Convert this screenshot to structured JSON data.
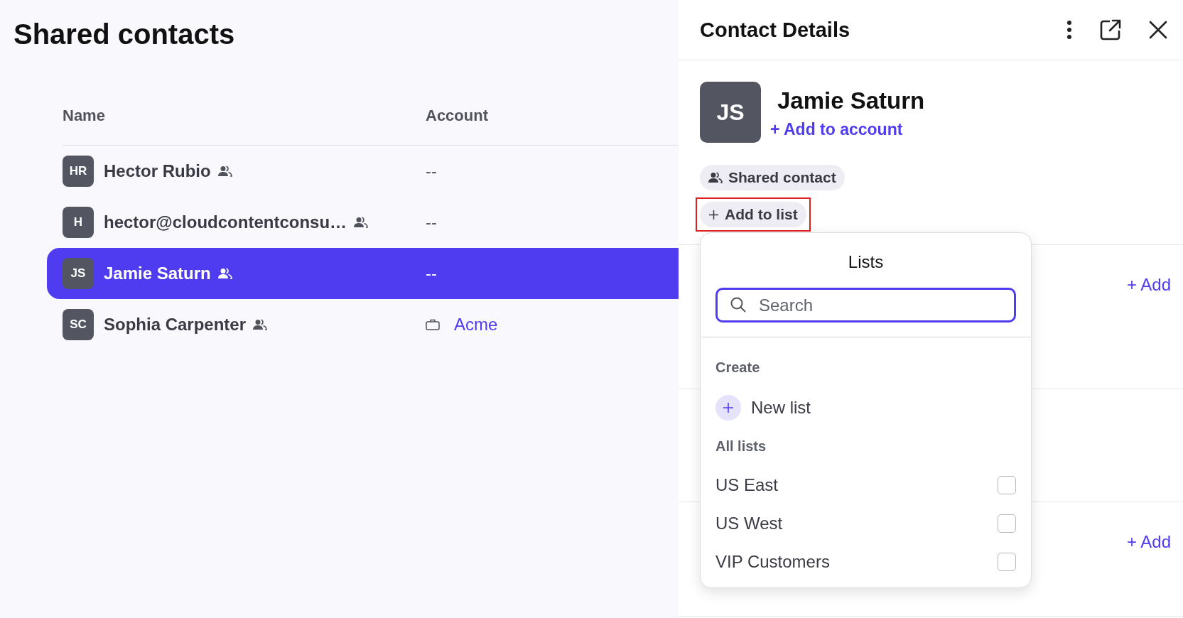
{
  "page": {
    "title": "Shared contacts"
  },
  "table": {
    "columns": [
      "Name",
      "Account"
    ],
    "rows": [
      {
        "initials": "HR",
        "name": "Hector Rubio",
        "shared": true,
        "account": "--",
        "kind": "none",
        "selected": false
      },
      {
        "initials": "H",
        "name": "hector@cloudcontentconsu…",
        "shared": true,
        "account": "--",
        "kind": "none",
        "selected": false
      },
      {
        "initials": "JS",
        "name": "Jamie Saturn",
        "shared": true,
        "account": "--",
        "kind": "none",
        "selected": true
      },
      {
        "initials": "SC",
        "name": "Sophia Carpenter",
        "shared": true,
        "account": "Acme",
        "kind": "link",
        "selected": false
      }
    ]
  },
  "details": {
    "title": "Contact Details",
    "initials": "JS",
    "name": "Jamie Saturn",
    "add_to_account": "+ Add to account",
    "tag": "Shared contact",
    "add_to_list": {
      "label": "Add to list",
      "highlighted": true
    },
    "sections": [
      {
        "kind": "add",
        "add": "+ Add"
      },
      {
        "kind": "blank"
      },
      {
        "kind": "add",
        "add": "+ Add"
      }
    ]
  },
  "lists_menu": {
    "title": "Lists",
    "search": {
      "placeholder": "Search"
    },
    "create_heading": "Create",
    "new_list": "New list",
    "all_heading": "All lists",
    "items": [
      {
        "label": "US East",
        "checked": false
      },
      {
        "label": "US West",
        "checked": false
      },
      {
        "label": "VIP Customers",
        "checked": false
      }
    ]
  }
}
